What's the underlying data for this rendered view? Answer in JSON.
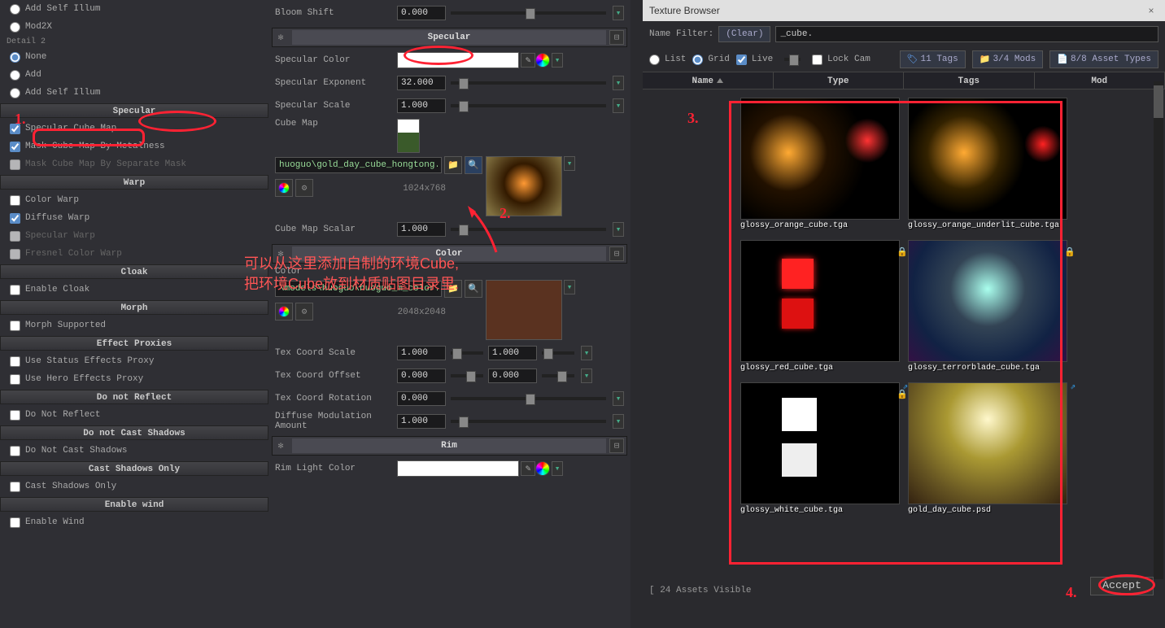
{
  "left": {
    "radios1": [
      {
        "label": "Add Self Illum",
        "checked": false
      },
      {
        "label": "Mod2X",
        "checked": false
      }
    ],
    "detail2_header": "Detail 2",
    "radios2": [
      {
        "label": "None",
        "checked": true
      },
      {
        "label": "Add",
        "checked": false
      },
      {
        "label": "Add Self Illum",
        "checked": false
      }
    ],
    "sections": [
      {
        "title": "Specular",
        "checks": [
          {
            "label": "Specular Cube Map",
            "checked": true,
            "disabled": false
          },
          {
            "label": "Mask Cube Map By Metalness",
            "checked": true,
            "disabled": false
          },
          {
            "label": "Mask Cube Map By Separate Mask",
            "checked": false,
            "disabled": true
          }
        ]
      },
      {
        "title": "Warp",
        "checks": [
          {
            "label": "Color Warp",
            "checked": false,
            "disabled": false
          },
          {
            "label": "Diffuse Warp",
            "checked": true,
            "disabled": false
          },
          {
            "label": "Specular Warp",
            "checked": false,
            "disabled": true
          },
          {
            "label": "Fresnel Color Warp",
            "checked": false,
            "disabled": true
          }
        ]
      },
      {
        "title": "Cloak",
        "checks": [
          {
            "label": "Enable Cloak",
            "checked": false,
            "disabled": false
          }
        ]
      },
      {
        "title": "Morph",
        "checks": [
          {
            "label": "Morph Supported",
            "checked": false,
            "disabled": false
          }
        ]
      },
      {
        "title": "Effect Proxies",
        "checks": [
          {
            "label": "Use Status Effects Proxy",
            "checked": false,
            "disabled": false
          },
          {
            "label": "Use Hero Effects Proxy",
            "checked": false,
            "disabled": false
          }
        ]
      },
      {
        "title": "Do not Reflect",
        "checks": [
          {
            "label": "Do Not Reflect",
            "checked": false,
            "disabled": false
          }
        ]
      },
      {
        "title": "Do not Cast Shadows",
        "checks": [
          {
            "label": "Do Not Cast Shadows",
            "checked": false,
            "disabled": false
          }
        ]
      },
      {
        "title": "Cast Shadows Only",
        "checks": [
          {
            "label": "Cast Shadows Only",
            "checked": false,
            "disabled": false
          }
        ]
      },
      {
        "title": "Enable wind",
        "checks": [
          {
            "label": "Enable Wind",
            "checked": false,
            "disabled": false
          }
        ]
      }
    ]
  },
  "mid": {
    "bloom_shift": {
      "label": "Bloom Shift",
      "value": "0.000"
    },
    "specular_header": "Specular",
    "specular_color_label": "Specular Color",
    "specular_exponent": {
      "label": "Specular Exponent",
      "value": "32.000"
    },
    "specular_scale": {
      "label": "Specular Scale",
      "value": "1.000"
    },
    "cube_map_label": "Cube Map",
    "cube_map_path": "huoguo\\gold_day_cube_hongtong.tga",
    "cube_map_dim": "1024x768",
    "cube_map_scalar": {
      "label": "Cube Map Scalar",
      "value": "1.000"
    },
    "color_header": "Color",
    "color_label": "Color",
    "color_path": "\\models\\huoguo\\huoguo_m_color.png",
    "color_dim": "2048x2048",
    "tex_coord_scale": {
      "label": "Tex Coord Scale",
      "v1": "1.000",
      "v2": "1.000"
    },
    "tex_coord_offset": {
      "label": "Tex Coord Offset",
      "v1": "0.000",
      "v2": "0.000"
    },
    "tex_coord_rotation": {
      "label": "Tex Coord Rotation",
      "value": "0.000"
    },
    "diffuse_mod": {
      "label": "Diffuse Modulation Amount",
      "value": "1.000"
    },
    "rim_header": "Rim",
    "rim_light_color_label": "Rim Light Color"
  },
  "right": {
    "window_title": "Texture Browser",
    "name_filter_label": "Name Filter:",
    "clear_btn": "(Clear)",
    "filter_value": "_cube.",
    "list_label": "List",
    "grid_label": "Grid",
    "live_label": "Live",
    "lock_cam_label": "Lock Cam",
    "tags_btn": "11 Tags",
    "mods_btn": "3/4 Mods",
    "asset_types_btn": "8/8 Asset Types",
    "headers": [
      "Name",
      "Type",
      "Tags",
      "Mod"
    ],
    "textures": [
      {
        "name": "glossy_orange_cube.tga",
        "cls": "glossy-orange"
      },
      {
        "name": "glossy_orange_underlit_cube.tga",
        "cls": "glossy-orange-under"
      },
      {
        "name": "glossy_red_cube.tga",
        "cls": "glossy-red",
        "lock": true
      },
      {
        "name": "glossy_terrorblade_cube.tga",
        "cls": "glossy-terror",
        "lock": true
      },
      {
        "name": "glossy_white_cube.tga",
        "cls": "glossy-white",
        "link": true,
        "lock": true
      },
      {
        "name": "gold_day_cube.psd",
        "cls": "gold-day",
        "link": true
      }
    ],
    "status": "24 Assets Visible",
    "accept": "Accept"
  },
  "annotations": {
    "n1": "1.",
    "n2": "2.",
    "n3": "3.",
    "n4": "4.",
    "text1": "可以从这里添加自制的环境Cube,",
    "text2": "把环境Cube放到材质贴图目录里."
  }
}
